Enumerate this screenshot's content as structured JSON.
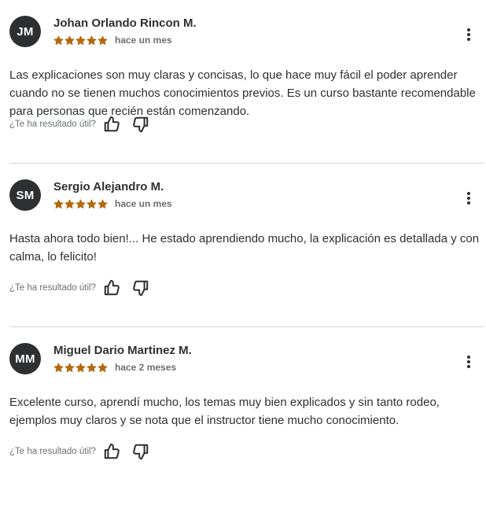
{
  "helpful_label": "¿Te ha resultado útil?",
  "colors": {
    "star": "#b4690e",
    "avatar_bg": "#2d2f31",
    "divider": "#d1d7dc"
  },
  "reviews": [
    {
      "initials": "JM",
      "name": "Johan Orlando Rincon M.",
      "rating": 5,
      "time": "hace un mes",
      "text": "Las explicaciones son muy claras y concisas, lo que hace muy fácil el poder aprender cuando no se tienen muchos conocimientos previos. Es un curso bastante recomendable para personas que recién están comenzando."
    },
    {
      "initials": "SM",
      "name": "Sergio Alejandro M.",
      "rating": 5,
      "time": "hace un mes",
      "text": "Hasta ahora todo bien!... He estado aprendiendo mucho, la explicación es detallada y con calma, lo felicito!"
    },
    {
      "initials": "MM",
      "name": "Miguel Dario Martinez M.",
      "rating": 5,
      "time": "hace 2 meses",
      "text": "Excelente curso, aprendí mucho, los temas muy bien explicados y sin tanto rodeo, ejemplos muy claros y se nota que el instructor tiene mucho conocimiento."
    }
  ],
  "icons": {
    "star": "star-icon",
    "menu": "more-vertical-icon",
    "thumb_up": "thumbs-up-icon",
    "thumb_down": "thumbs-down-icon"
  }
}
